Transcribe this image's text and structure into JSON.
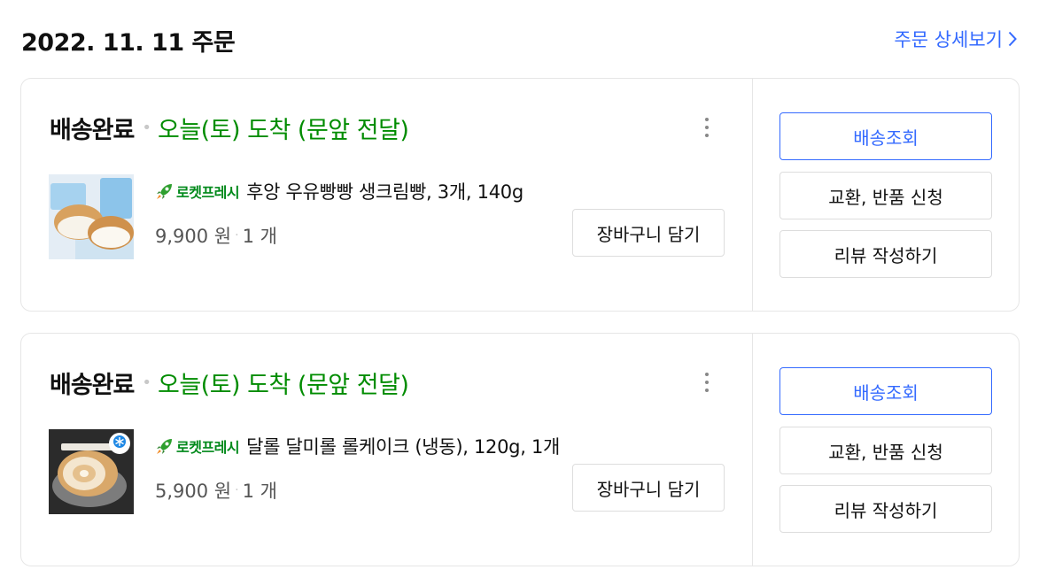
{
  "header": {
    "order_date": "2022. 11. 11 주문",
    "detail_link": "주문 상세보기"
  },
  "colors": {
    "accent": "#346aff",
    "arrival_green": "#008c00",
    "rocket_fresh_green": "#00891a"
  },
  "orders": [
    {
      "status": "배송완료",
      "separator": "•",
      "arrival": "오늘(토) 도착 (문앞 전달)",
      "badge": "로켓프레시",
      "badge_icon": "rocket-icon",
      "product_name": "후앙 우유빵빵 생크림빵, 3개, 140g",
      "price": "9,900 원",
      "price_separator": "·",
      "quantity": "1 개",
      "cart_button": "장바구니 담기",
      "actions": {
        "track": "배송조회",
        "exchange": "교환, 반품 신청",
        "review": "리뷰 작성하기"
      }
    },
    {
      "status": "배송완료",
      "separator": "•",
      "arrival": "오늘(토) 도착 (문앞 전달)",
      "badge": "로켓프레시",
      "badge_icon": "rocket-icon",
      "product_name": "달롤 달미롤 롤케이크 (냉동), 120g, 1개",
      "price": "5,900 원",
      "price_separator": "·",
      "quantity": "1 개",
      "cart_button": "장바구니 담기",
      "actions": {
        "track": "배송조회",
        "exchange": "교환, 반품 신청",
        "review": "리뷰 작성하기"
      }
    }
  ]
}
